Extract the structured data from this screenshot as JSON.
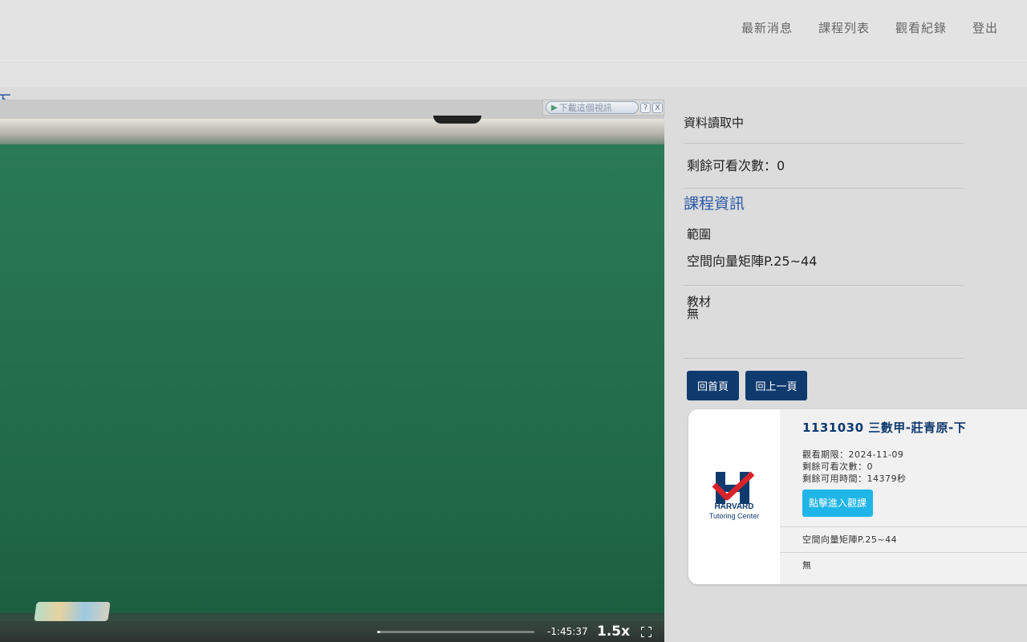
{
  "nav": {
    "items": [
      "最新消息",
      "課程列表",
      "觀看紀錄",
      "登出"
    ]
  },
  "page": {
    "title_fragment": "下"
  },
  "player": {
    "download_label": "下載這個視訊",
    "help_glyph": "?",
    "close_glyph": "X",
    "time_remaining": "-1:45:37",
    "speed": "1.5x",
    "progress_fraction": 0.02
  },
  "panel": {
    "status": "資料讀取中",
    "remaining_views": "剩餘可看次數：0",
    "section_title": "課程資訊",
    "range_label": "範圍",
    "range_value": "空間向量矩陣P.25~44",
    "material_label": "教材",
    "material_value": "無",
    "home_button": "回首頁",
    "back_button": "回上一頁"
  },
  "card": {
    "title": "1131030 三數甲-莊青原-下",
    "deadline": "觀看期限：2024-11-09",
    "views_left": "剩餘可看次數：0",
    "time_left": "剩餘可用時間：14379秒",
    "enter_button": "點擊進入觀課",
    "range": "空間向量矩陣P.25~44",
    "material": "無",
    "logo_word": "HARVARD",
    "logo_sub": "Tutoring Center"
  },
  "colors": {
    "brand_navy": "#0f3a6e",
    "accent_cyan": "#1fb5e8",
    "link_blue": "#2a5aa8",
    "logo_red": "#d8232a"
  }
}
